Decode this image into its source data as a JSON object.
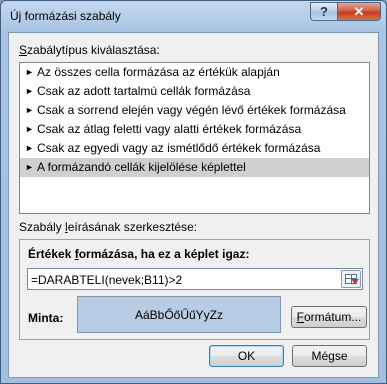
{
  "window": {
    "title": "Új formázási szabály",
    "help_label": "?",
    "close_label": "✕"
  },
  "rule_type": {
    "heading": "Szabálytípus kiválasztása:",
    "heading_mnemonic_pre": "",
    "heading_mnemonic": "S",
    "heading_rest": "zabálytípus kiválasztása:",
    "items": [
      {
        "label": "Az összes cella formázása az értékük alapján",
        "selected": false
      },
      {
        "label": "Csak az adott tartalmú cellák formázása",
        "selected": false
      },
      {
        "label": "Csak a sorrend elején vagy végén lévő értékek formázása",
        "selected": false
      },
      {
        "label": "Csak az átlag feletti vagy alatti értékek formázása",
        "selected": false
      },
      {
        "label": "Csak az egyedi vagy az ismétlődő értékek formázása",
        "selected": false
      },
      {
        "label": "A formázandó cellák kijelölése képlettel",
        "selected": true
      }
    ],
    "item_icon": "triangle-right-icon"
  },
  "description": {
    "heading_pre": "Szabály ",
    "heading_mnemonic": "l",
    "heading_rest": "eírásának szerkesztése:",
    "formula_heading_pre": "Értékek ",
    "formula_heading_mnemonic": "f",
    "formula_heading_rest": "ormázása, ha ez a képlet igaz:",
    "formula_value": "=DARABTELI(nevek;B11)>2",
    "preview_label": "Minta:",
    "preview_text": "AáBbŐőŰűYyZz",
    "preview_bg": "#b8cce4",
    "format_button_mnemonic": "F",
    "format_button_rest": "ormátum..."
  },
  "buttons": {
    "ok": "OK",
    "cancel": "Mégse"
  },
  "colors": {
    "frame": "#a9c5e3",
    "close": "#c3391b"
  }
}
